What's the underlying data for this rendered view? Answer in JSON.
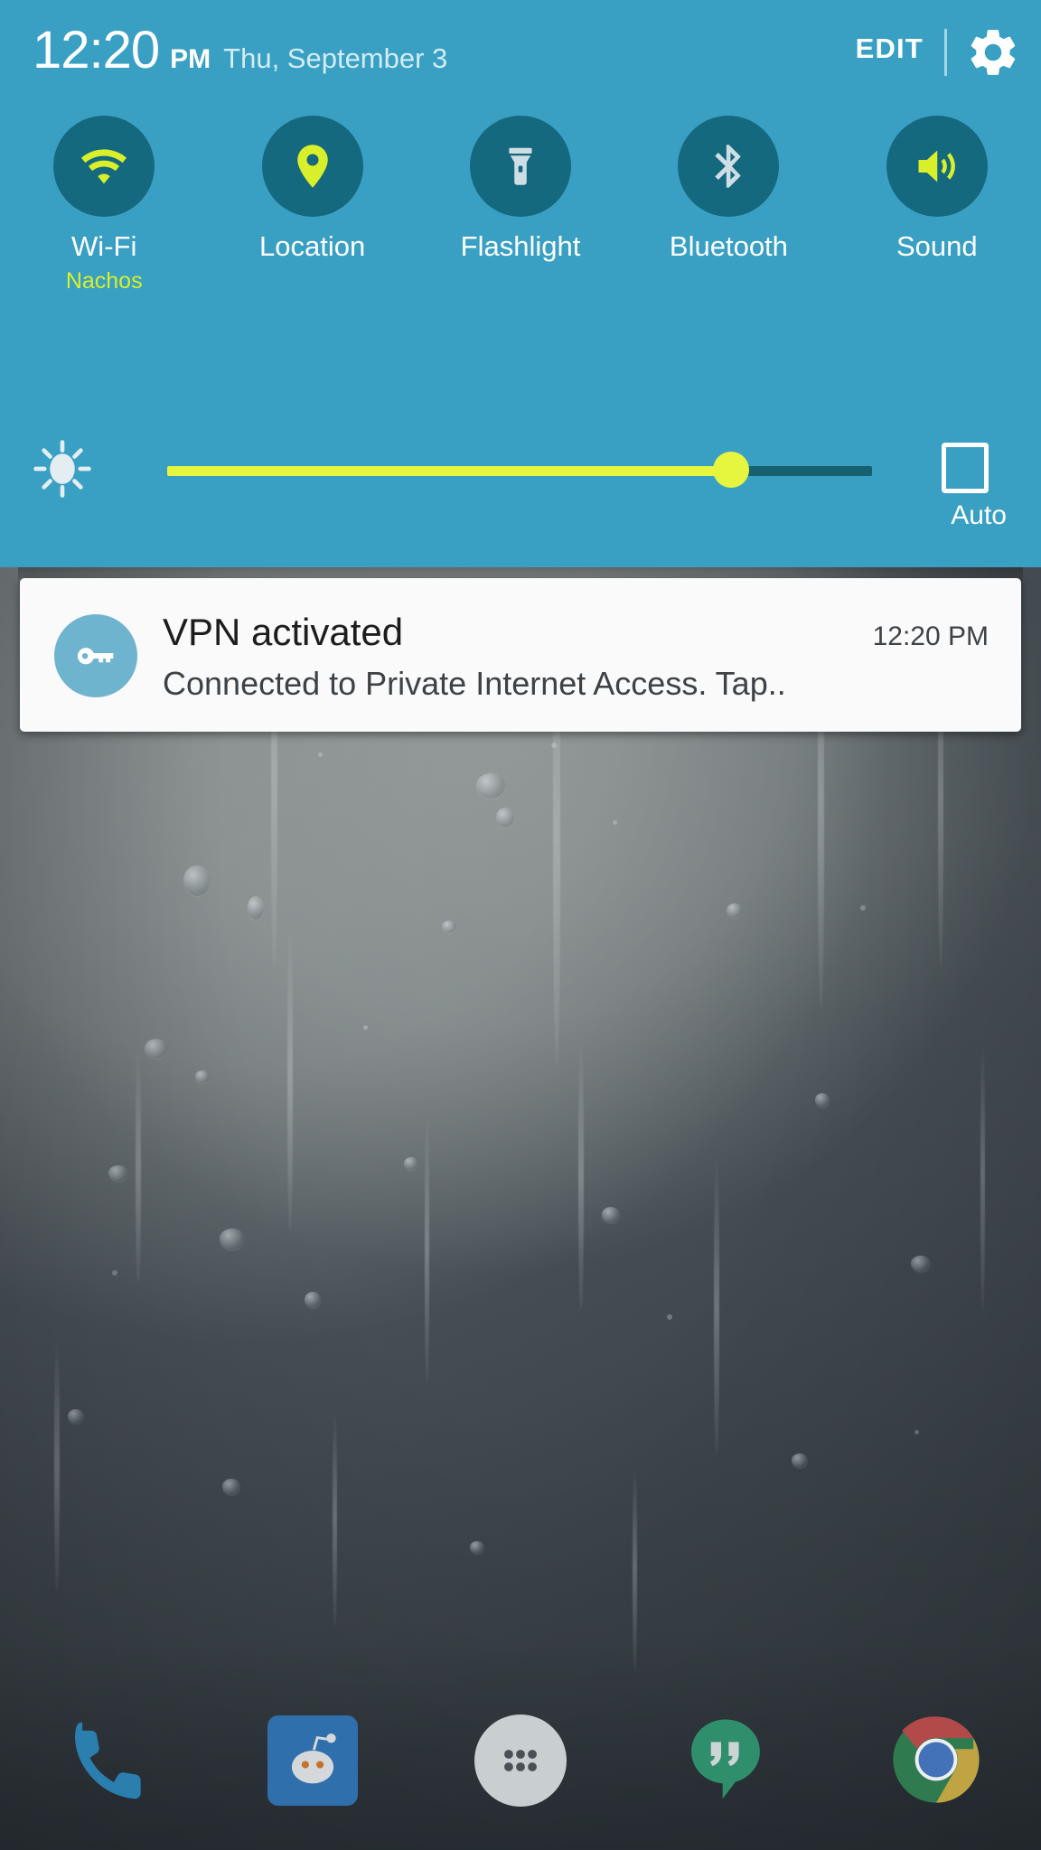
{
  "statusbar": {
    "time": "12:20",
    "ampm": "PM",
    "date": "Thu, September 3"
  },
  "header": {
    "edit_label": "EDIT",
    "gear_icon": "gear-icon"
  },
  "colors": {
    "panel_bg": "#39a0c4",
    "toggle_circle": "#15697f",
    "active_icon": "#d9ef2a",
    "inactive_icon": "#cfdde4",
    "slider_fill": "#e6f63f",
    "slider_track": "#16606f",
    "notif_card": "#fafafa",
    "notif_icon_bg": "#6fb4ce"
  },
  "quick_settings": {
    "toggles": [
      {
        "label": "Wi-Fi",
        "sublabel": "Nachos",
        "icon": "wifi-icon",
        "active": true
      },
      {
        "label": "Location",
        "sublabel": "",
        "icon": "location-pin-icon",
        "active": true
      },
      {
        "label": "Flashlight",
        "sublabel": "",
        "icon": "flashlight-icon",
        "active": false
      },
      {
        "label": "Bluetooth",
        "sublabel": "",
        "icon": "bluetooth-icon",
        "active": false
      },
      {
        "label": "Sound",
        "sublabel": "",
        "icon": "sound-volume-icon",
        "active": true
      }
    ]
  },
  "brightness": {
    "icon": "brightness-sun-icon",
    "value_percent": 80,
    "auto_label": "Auto",
    "auto_checked": false
  },
  "notification": {
    "icon": "vpn-key-icon",
    "title": "VPN activated",
    "time": "12:20 PM",
    "body": "Connected to Private Internet Access. Tap.."
  },
  "dock": {
    "items": [
      {
        "name": "phone",
        "icon": "phone-icon"
      },
      {
        "name": "reddit",
        "icon": "reddit-icon"
      },
      {
        "name": "app-drawer",
        "icon": "app-drawer-icon"
      },
      {
        "name": "hangouts",
        "icon": "hangouts-icon"
      },
      {
        "name": "chrome",
        "icon": "chrome-icon"
      }
    ]
  }
}
